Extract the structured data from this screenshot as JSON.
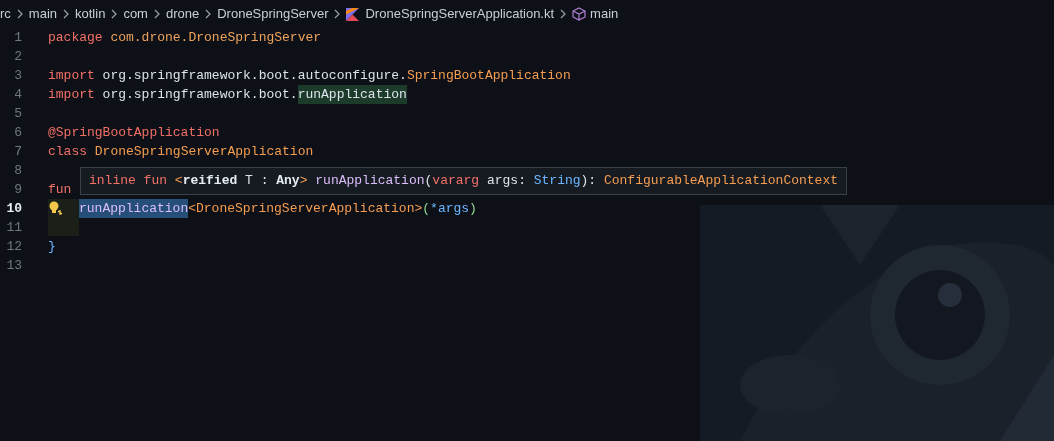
{
  "breadcrumbs": [
    {
      "label": "rc",
      "kind": "folder"
    },
    {
      "label": "main",
      "kind": "folder"
    },
    {
      "label": "kotlin",
      "kind": "folder"
    },
    {
      "label": "com",
      "kind": "folder"
    },
    {
      "label": "drone",
      "kind": "folder"
    },
    {
      "label": "DroneSpringServer",
      "kind": "folder"
    },
    {
      "label": "DroneSpringServerApplication.kt",
      "kind": "kotlin-file"
    },
    {
      "label": "main",
      "kind": "method"
    }
  ],
  "editor": {
    "lines": [
      {
        "number": "1",
        "current": false,
        "tokens": [
          {
            "text": "package",
            "kind": "keyword"
          },
          {
            "text": " com.drone.DroneSpringServer",
            "kind": "package"
          }
        ]
      },
      {
        "number": "2",
        "current": false
      },
      {
        "number": "3",
        "current": false,
        "tokens": [
          {
            "text": "import",
            "kind": "keyword"
          },
          {
            "text": " org.springframework.boot.autoconfigure.",
            "kind": "plain"
          },
          {
            "text": "SpringBootApplication",
            "kind": "type"
          }
        ]
      },
      {
        "number": "4",
        "current": false,
        "tokens": [
          {
            "text": "import",
            "kind": "keyword"
          },
          {
            "text": " org.springframework.boot.",
            "kind": "plain"
          },
          {
            "text": "runApplication",
            "kind": "plain",
            "highlighted": true
          }
        ]
      },
      {
        "number": "5",
        "current": false
      },
      {
        "number": "6",
        "current": false,
        "tokens": [
          {
            "text": "@SpringBootApplication",
            "kind": "annotation"
          }
        ]
      },
      {
        "number": "7",
        "current": false,
        "tokens": [
          {
            "text": "class",
            "kind": "keyword"
          },
          {
            "text": " DroneSpringServerApplication",
            "kind": "type"
          }
        ]
      },
      {
        "number": "8",
        "current": false
      },
      {
        "number": "9",
        "current": false,
        "tokens": [
          {
            "text": "fun",
            "kind": "keyword"
          }
        ]
      },
      {
        "number": "10",
        "current": true,
        "lightbulb": true,
        "tokens": [
          {
            "text": "runApplication",
            "kind": "function",
            "selected": true
          },
          {
            "text": "<DroneSpringServerApplication>",
            "kind": "type"
          },
          {
            "text": "(",
            "kind": "paren"
          },
          {
            "text": "*args",
            "kind": "param"
          },
          {
            "text": ")",
            "kind": "paren"
          }
        ]
      },
      {
        "number": "11",
        "current": false
      },
      {
        "number": "12",
        "current": false,
        "tokens": [
          {
            "text": "}",
            "kind": "brace"
          }
        ]
      },
      {
        "number": "13",
        "current": false
      }
    ]
  },
  "hover": {
    "tokens": [
      {
        "text": "inline fun ",
        "kind": "keyword"
      },
      {
        "text": "<",
        "kind": "angle"
      },
      {
        "text": "reified",
        "kind": "bold"
      },
      {
        "text": " T : ",
        "kind": "plain"
      },
      {
        "text": "Any",
        "kind": "bold"
      },
      {
        "text": ">",
        "kind": "angle"
      },
      {
        "text": " runApplication",
        "kind": "function"
      },
      {
        "text": "(",
        "kind": "plain"
      },
      {
        "text": "vararg",
        "kind": "keyword"
      },
      {
        "text": " args: ",
        "kind": "plain"
      },
      {
        "text": "String",
        "kind": "builtin"
      },
      {
        "text": "): ",
        "kind": "plain"
      },
      {
        "text": "ConfigurableApplicationContext",
        "kind": "type"
      }
    ]
  }
}
